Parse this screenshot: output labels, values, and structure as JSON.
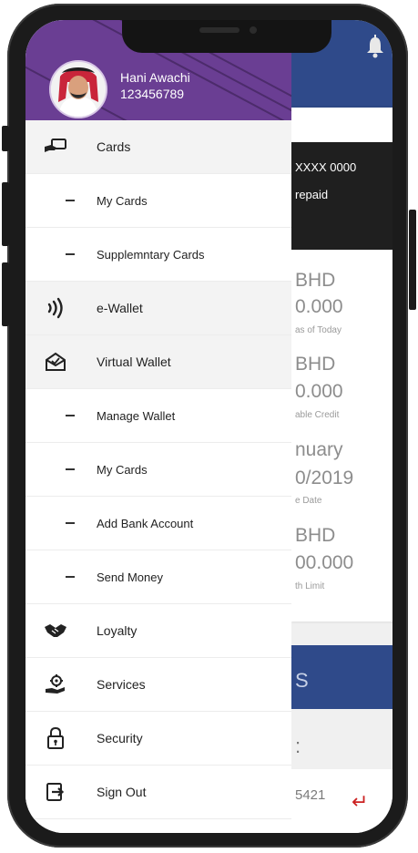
{
  "user": {
    "name": "Hani Awachi",
    "id": "123456789"
  },
  "menu": {
    "items": [
      {
        "label": "Cards",
        "icon": "card-hand-icon"
      },
      {
        "label": "My Cards"
      },
      {
        "label": "Supplemntary Cards"
      },
      {
        "label": "e-Wallet",
        "icon": "contactless-icon"
      },
      {
        "label": "Virtual Wallet",
        "icon": "open-envelope-icon"
      },
      {
        "label": "Manage Wallet"
      },
      {
        "label": "My Cards"
      },
      {
        "label": "Add Bank Account"
      },
      {
        "label": "Send Money"
      },
      {
        "label": "Loyalty",
        "icon": "handshake-icon"
      },
      {
        "label": "Services",
        "icon": "hand-gear-icon"
      },
      {
        "label": "Security",
        "icon": "padlock-icon"
      },
      {
        "label": "Sign Out",
        "icon": "sign-out-icon"
      }
    ]
  },
  "background": {
    "card_number": "XXXX 0000",
    "card_type": "repaid",
    "balance_currency": "BHD",
    "balance_value": "0.000",
    "balance_caption": "as of Today",
    "available_currency": "BHD",
    "available_value": "0.000",
    "available_caption": "able Credit",
    "due_month": "nuary",
    "due_date": "0/2019",
    "due_caption": "e Date",
    "limit_currency": "BHD",
    "limit_value": "00.000",
    "limit_caption": "th Limit",
    "button_fragment": "S",
    "section_fragment": ":",
    "account_fragment": "5421"
  },
  "colors": {
    "drawer_header": "#6a3e93",
    "app_header": "#2f4a8a",
    "accent_red": "#cc2222"
  }
}
